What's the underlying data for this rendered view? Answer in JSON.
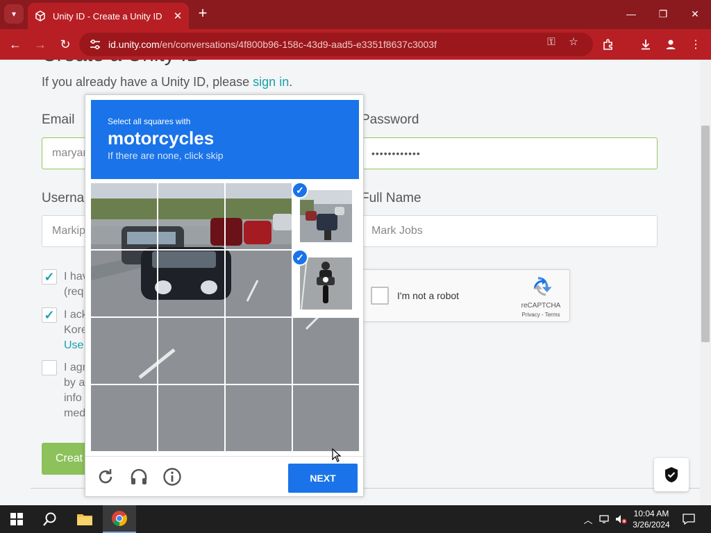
{
  "browser": {
    "tab_title": "Unity ID - Create a Unity ID",
    "url_domain": "id.unity.com",
    "url_path": "/en/conversations/4f800b96-158c-43d9-aad5-e3351f8637c3003f"
  },
  "page": {
    "heading": "Create a Unity ID",
    "signin_prefix": "If you already have a Unity ID, please ",
    "signin_link": "sign in",
    "signin_suffix": ".",
    "email_label": "Email",
    "email_value": "maryar",
    "password_label": "Password",
    "password_value": "••••••••••••",
    "username_label": "Userna",
    "username_value": "Markip",
    "fullname_label": "Full Name",
    "fullname_value": "Mark Jobs",
    "checkbox1_text": "I hav\n(req",
    "checkbox2_text": "I ack\nKore",
    "checkbox2_link": "Use",
    "checkbox3_text": "I agr\nby a\ninfo\nmed",
    "create_button": "Creat"
  },
  "recaptcha": {
    "label": "I'm not a robot",
    "brand": "reCAPTCHA",
    "links": "Privacy - Terms"
  },
  "challenge": {
    "line1": "Select all squares with",
    "target": "motorcycles",
    "line3": "If there are none, click skip",
    "next_button": "NEXT",
    "selected_cells": [
      3,
      7
    ]
  },
  "taskbar": {
    "time": "10:04 AM",
    "date": "3/26/2024"
  },
  "colors": {
    "browser_frame": "#8b1a1f",
    "toolbar": "#b81f24",
    "captcha_blue": "#1a73e8",
    "unity_link": "#1a9fa8",
    "create_green": "#8cc15b"
  }
}
